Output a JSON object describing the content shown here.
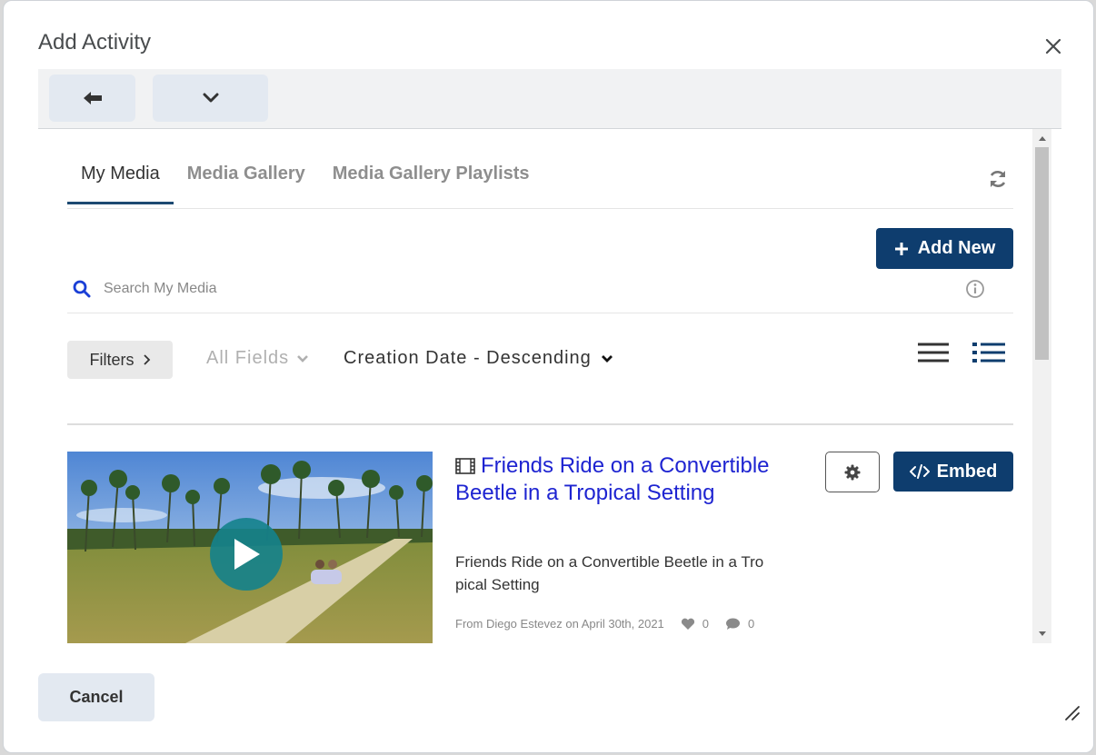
{
  "dialog": {
    "title": "Add Activity"
  },
  "tabs": [
    "My Media",
    "Media Gallery",
    "Media Gallery Playlists"
  ],
  "actions": {
    "add_new": "Add New"
  },
  "search": {
    "placeholder": "Search My Media"
  },
  "filters": {
    "label": "Filters",
    "fields": "All Fields",
    "sort": "Creation Date - Descending"
  },
  "entry": {
    "title": "Friends Ride on a Convertible Beetle in a Tropical Setting",
    "description": "Friends Ride on a Convertible Beetle in a Tro pical Setting",
    "meta": "From Diego Estevez on April 30th, 2021",
    "likes": "0",
    "comments": "0",
    "embed_label": "Embed"
  },
  "footer": {
    "cancel": "Cancel"
  },
  "colors": {
    "primary": "#0e3d6e",
    "link": "#1e24d1",
    "search_icon": "#1a3fd6"
  }
}
